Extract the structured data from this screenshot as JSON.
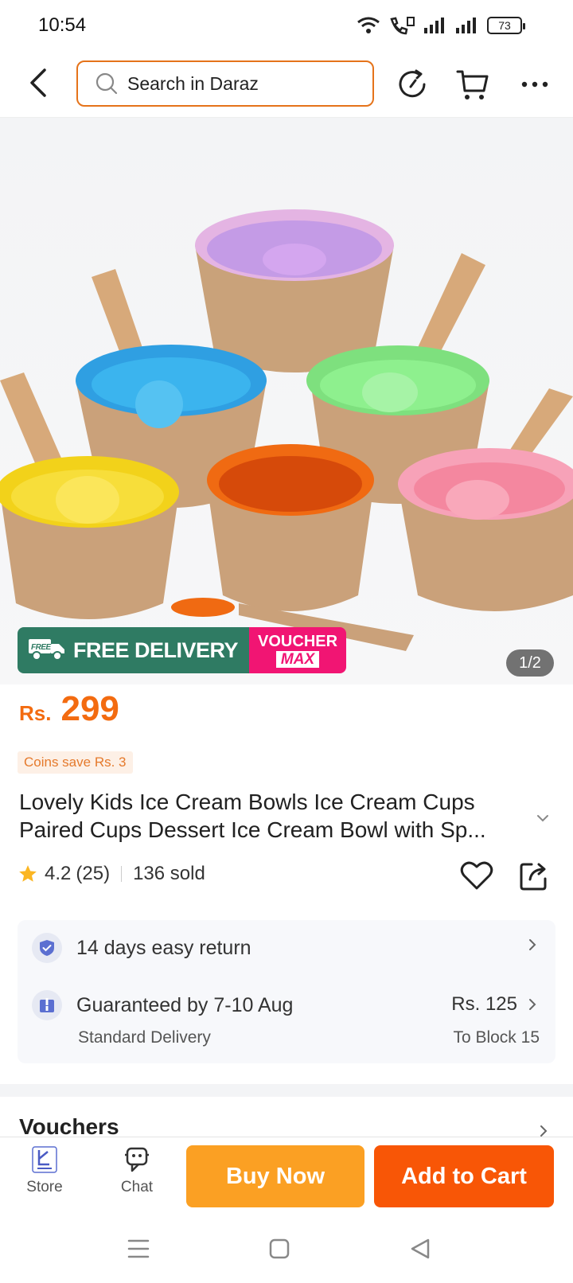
{
  "status_bar": {
    "time": "10:54",
    "battery": "73"
  },
  "header": {
    "search_placeholder": "Search in Daraz",
    "icons": [
      "back-arrow-icon",
      "search-icon",
      "history-icon",
      "cart-icon",
      "more-icon"
    ]
  },
  "product": {
    "image_pager": "1/2",
    "badge": {
      "free_label": "FREE",
      "delivery_label": "FREE DELIVERY",
      "voucher_line1": "VOUCHER",
      "voucher_line2": "MAX"
    },
    "price_currency": "Rs.",
    "price_amount": "299",
    "coins_text": "Coins save Rs. 3",
    "title": "Lovely Kids Ice Cream Bowls Ice Cream Cups Paired Cups Dessert Ice Cream Bowl with Sp...",
    "rating": "4.2",
    "rating_count": "(25)",
    "sold": "136 sold"
  },
  "service": {
    "return_text": "14 days easy return",
    "delivery_text": "Guaranteed by 7-10 Aug",
    "delivery_type": "Standard Delivery",
    "delivery_fee": "Rs. 125",
    "delivery_location": "To Block 15"
  },
  "vouchers_heading": "Vouchers",
  "bottom_bar": {
    "store_label": "Store",
    "chat_label": "Chat",
    "buy_now_label": "Buy Now",
    "add_to_cart_label": "Add to Cart"
  },
  "colors": {
    "brand_orange": "#f85606",
    "buy_now": "#fba023",
    "price": "#f36b10",
    "search_border": "#e5731a",
    "free_delivery_green": "#2f7b63",
    "voucher_pink": "#f11573"
  }
}
